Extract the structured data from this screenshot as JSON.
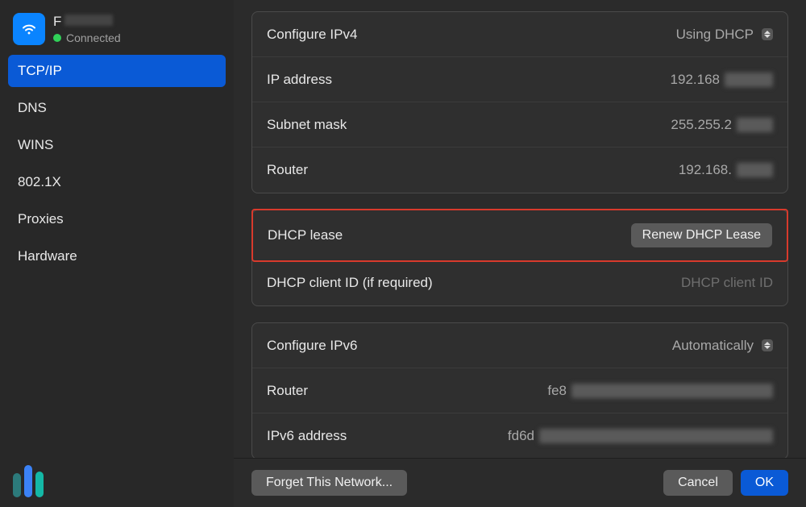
{
  "sidebar": {
    "network_name_prefix": "F",
    "status_label": "Connected",
    "items": [
      {
        "label": "TCP/IP",
        "selected": true
      },
      {
        "label": "DNS",
        "selected": false
      },
      {
        "label": "WINS",
        "selected": false
      },
      {
        "label": "802.1X",
        "selected": false
      },
      {
        "label": "Proxies",
        "selected": false
      },
      {
        "label": "Hardware",
        "selected": false
      }
    ]
  },
  "ipv4_group": {
    "configure_label": "Configure IPv4",
    "configure_value": "Using DHCP",
    "ip_label": "IP address",
    "ip_prefix": "192.168",
    "subnet_label": "Subnet mask",
    "subnet_prefix": "255.255.2",
    "router_label": "Router",
    "router_prefix": "192.168."
  },
  "dhcp_group": {
    "lease_label": "DHCP lease",
    "renew_button": "Renew DHCP Lease",
    "client_id_label": "DHCP client ID (if required)",
    "client_id_placeholder": "DHCP client ID"
  },
  "ipv6_group": {
    "configure_label": "Configure IPv6",
    "configure_value": "Automatically",
    "router_label": "Router",
    "router_prefix": "fe8",
    "address_label": "IPv6 address",
    "address_prefix": "fd6d"
  },
  "footer": {
    "forget_label": "Forget This Network...",
    "cancel_label": "Cancel",
    "ok_label": "OK"
  }
}
